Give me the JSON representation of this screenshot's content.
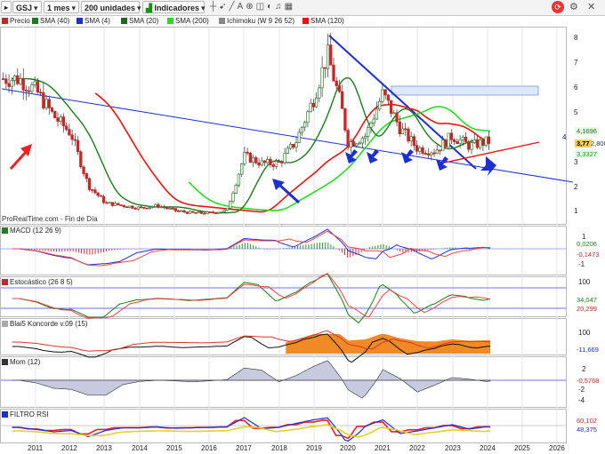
{
  "toolbar": {
    "symbol": "GSJ",
    "period": "1 mes",
    "units": "200 unidades",
    "indicators": "Indicadores"
  },
  "legend": [
    "Precio",
    "SMA (40)",
    "SMA (4)",
    "SMA (20)",
    "SMA (200)",
    "Ichimoku (W 9 26 52)",
    "SMA (120)"
  ],
  "colors": {
    "price_up": "#2e7d32",
    "price_down": "#c62828",
    "sma40": "#1b7a1b",
    "sma120": "#ee1111",
    "sma200": "#22dd22",
    "trendline": "#1c2fd1",
    "arrow_red": "#ee2222",
    "arrow_blue": "#1c2fd1"
  },
  "main": {
    "watermark": "ProRealTime.com - Fin de Día",
    "y_ticks": [
      "8",
      "7",
      "6",
      "5",
      "4",
      "3",
      "2",
      "1"
    ],
    "price_tags": [
      "4,1696",
      "3,77",
      "3,3327",
      "2,800"
    ]
  },
  "macd": {
    "label": "MACD (12 26 9)",
    "tags": [
      "0,0206",
      "-0,1473"
    ],
    "y_ticks": [
      "1",
      "0",
      "-1"
    ]
  },
  "stoch": {
    "label": "Estocástico (26 8 5)",
    "tags": [
      "34,047",
      "20,299"
    ],
    "y_ticks": [
      "100",
      "50"
    ]
  },
  "koncorde": {
    "label": "Blai5 Koncorde v.09 (15)",
    "tags": [
      "-11,669"
    ],
    "y_ticks": [
      "100",
      "0"
    ]
  },
  "mom": {
    "label": "Mom (12)",
    "tags": [
      "-0,5768"
    ],
    "y_ticks": [
      "2",
      "0",
      "-2",
      "-4"
    ]
  },
  "rsi": {
    "label": "FILTRO RSI",
    "tags": [
      "60,102",
      "48,375"
    ],
    "y_ticks": [
      "60",
      "40"
    ]
  },
  "x_years": [
    "2011",
    "2012",
    "2013",
    "2014",
    "2015",
    "2016",
    "2017",
    "2018",
    "2019",
    "2020",
    "2021",
    "2022",
    "2023",
    "2024",
    "2025",
    "2026"
  ],
  "chart_data": {
    "type": "candlestick",
    "series_name": "GSJ",
    "period": "1 mes",
    "x_years": [
      2011,
      2012,
      2013,
      2014,
      2015,
      2016,
      2017,
      2018,
      2019,
      2020,
      2021,
      2022,
      2023,
      2024,
      2025,
      2026
    ],
    "approx_close": [
      [
        2010.5,
        6.3
      ],
      [
        2011.0,
        5.8
      ],
      [
        2011.5,
        4.8
      ],
      [
        2012.0,
        4.1
      ],
      [
        2012.5,
        2.0
      ],
      [
        2013.0,
        1.3
      ],
      [
        2013.5,
        1.2
      ],
      [
        2014.0,
        1.1
      ],
      [
        2014.5,
        1.2
      ],
      [
        2015.0,
        1.0
      ],
      [
        2015.5,
        0.9
      ],
      [
        2016.0,
        0.9
      ],
      [
        2016.5,
        1.0
      ],
      [
        2017.0,
        3.2
      ],
      [
        2017.5,
        2.9
      ],
      [
        2018.0,
        2.9
      ],
      [
        2018.5,
        3.8
      ],
      [
        2019.0,
        5.5
      ],
      [
        2019.4,
        7.3
      ],
      [
        2019.8,
        5.2
      ],
      [
        2020.0,
        3.7
      ],
      [
        2020.5,
        4.0
      ],
      [
        2021.0,
        5.7
      ],
      [
        2021.5,
        4.3
      ],
      [
        2022.0,
        3.5
      ],
      [
        2022.5,
        3.4
      ],
      [
        2023.0,
        4.0
      ],
      [
        2023.5,
        3.6
      ],
      [
        2024.0,
        3.77
      ]
    ],
    "ylim": [
      0.5,
      8.5
    ],
    "last": 3.77
  }
}
